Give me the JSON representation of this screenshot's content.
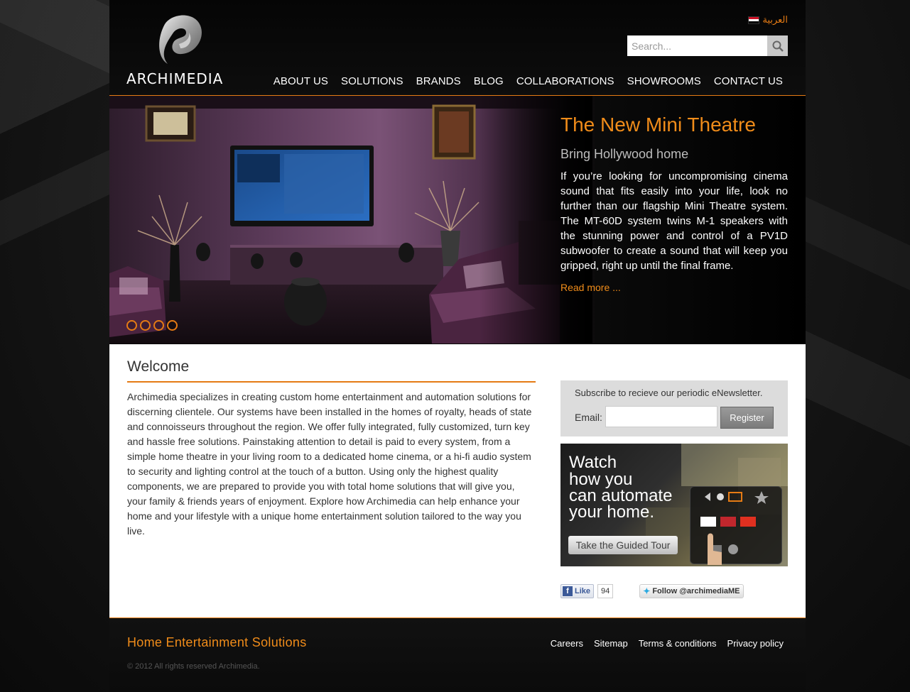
{
  "header": {
    "brand": "ARCHIMEDIA",
    "language_link": "العربية",
    "search_placeholder": "Search...",
    "nav": [
      "ABOUT US",
      "SOLUTIONS",
      "BRANDS",
      "BLOG",
      "COLLABORATIONS",
      "SHOWROOMS",
      "CONTACT US"
    ]
  },
  "hero": {
    "title": "The New Mini Theatre",
    "subtitle": "Bring Hollywood home",
    "body": "If you’re looking for uncompromising cinema sound that fits easily into your life, look no further than our flagship Mini Theatre system. The MT-60D system twins M-1 speakers with the stunning power and control of a PV1D subwoofer to create a sound that will keep you gripped, right up until the final frame.",
    "read_more": "Read more ...",
    "slide_count": 4
  },
  "welcome": {
    "title": "Welcome",
    "text": "Archimedia specializes in creating custom home entertainment and automation solutions for discerning clientele. Our systems have been installed in the homes of royalty, heads of state and connoisseurs throughout the region. We offer fully integrated, fully customized, turn key and hassle free solutions. Painstaking attention to detail is paid to every system, from a simple home theatre in your living room to a dedicated home cinema, or a hi-fi audio system to security and lighting control at the touch of a button. Using only the highest quality components, we are prepared to provide you with total home solutions that will give you, your family & friends years of enjoyment. Explore how Archimedia can help enhance your home and your lifestyle with a unique home entertainment solution tailored to the way you live."
  },
  "newsletter": {
    "prompt": "Subscribe to recieve our periodic eNewsletter.",
    "email_label": "Email:",
    "email_value": "",
    "button": "Register"
  },
  "tour_banner": {
    "lines": [
      "Watch",
      "how you",
      "can automate",
      "your home."
    ],
    "button": "Take the Guided Tour"
  },
  "social": {
    "like_label": "Like",
    "like_count": "94",
    "follow_label": "Follow @archimediaME"
  },
  "footer": {
    "title": "Home Entertainment Solutions",
    "copyright": "© 2012 All rights reserved Archimedia.",
    "links": [
      "Careers",
      "Sitemap",
      "Terms & conditions",
      "Privacy policy"
    ]
  },
  "colors": {
    "accent": "#e57b14",
    "page_background": "#070707",
    "content_background": "#ffffff"
  }
}
